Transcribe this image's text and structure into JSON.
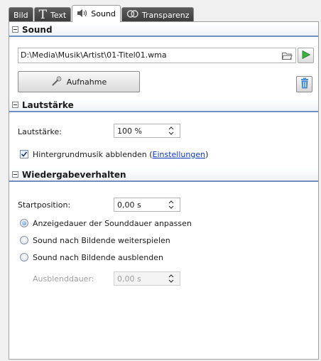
{
  "tabs": [
    {
      "label": "Bild",
      "icon": null,
      "active": false
    },
    {
      "label": "Text",
      "icon": "big-t-icon",
      "active": false
    },
    {
      "label": "Sound",
      "icon": "speaker-icon",
      "active": true
    },
    {
      "label": "Transparenz",
      "icon": "transparency-icon",
      "active": false
    }
  ],
  "sections": {
    "sound": "Sound",
    "volume": "Lautstärke",
    "playback": "Wiedergabeverhalten"
  },
  "sound": {
    "file_path": "D:\\Media\\Musik\\Artist\\01-Titel01.wma",
    "record_label": "Aufnahme"
  },
  "volume": {
    "label": "Lautstärke:",
    "value": "100 %",
    "fade_bg_label": "Hintergrundmusik abblenden (",
    "settings_link": "Einstellungen",
    "fade_bg_suffix": ")",
    "fade_bg_checked": true
  },
  "playback": {
    "start_label": "Startposition:",
    "start_value": "0,00 s",
    "options": [
      {
        "label": "Anzeigedauer der Sounddauer anpassen",
        "checked": true
      },
      {
        "label": "Sound nach Bildende weiterspielen",
        "checked": false
      },
      {
        "label": "Sound nach Bildende ausblenden",
        "checked": false
      }
    ],
    "fade_duration_label": "Ausblenddauer:",
    "fade_duration_value": "0,00 s"
  },
  "colors": {
    "section_underline": "#6f8fbf",
    "link": "#0b36c4",
    "play_green": "#3cb043"
  }
}
